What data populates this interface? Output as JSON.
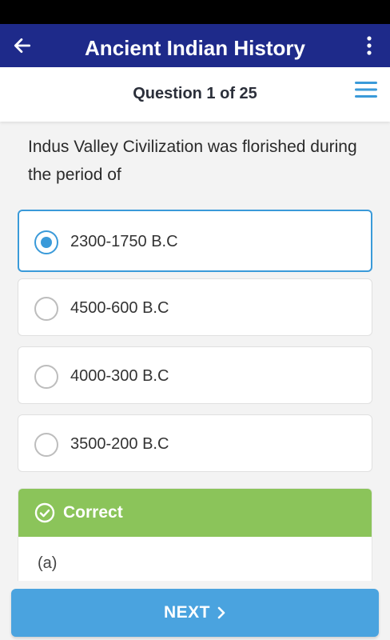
{
  "app_bar": {
    "title": "Ancient Indian History",
    "back_icon": "arrow-left-icon",
    "menu_icon": "more-vertical-icon",
    "background": "#1e2a8a"
  },
  "question_header": {
    "counter": "Question 1 of 25",
    "list_icon": "list-menu-icon"
  },
  "question": {
    "text": "Indus Valley Civilization was florished during the period of"
  },
  "options": [
    {
      "label": "2300-1750 B.C",
      "selected": true
    },
    {
      "label": "4500-600 B.C",
      "selected": false
    },
    {
      "label": "4000-300 B.C",
      "selected": false
    },
    {
      "label": "3500-200 B.C",
      "selected": false
    }
  ],
  "feedback": {
    "title": "Correct",
    "answer": "(a)",
    "icon": "check-circle-icon",
    "color": "#8bc45a"
  },
  "next_button": {
    "label": "NEXT",
    "icon": "chevron-right-icon",
    "color": "#4aa3df"
  },
  "colors": {
    "accent": "#3a9ad9"
  }
}
